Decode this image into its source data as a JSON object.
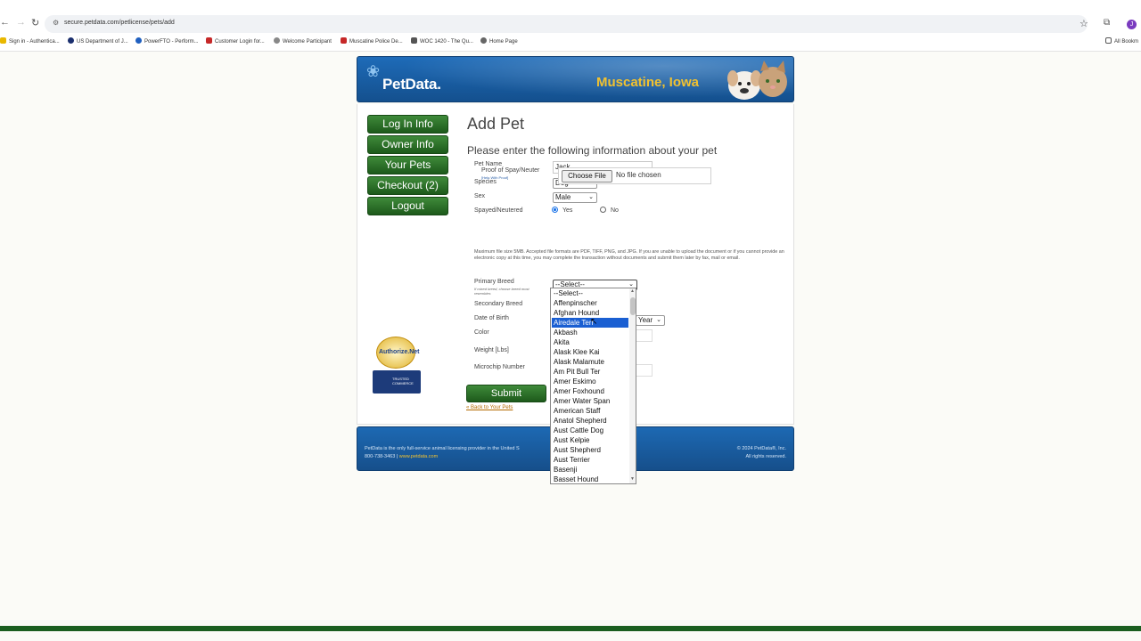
{
  "browser": {
    "url": "secure.petdata.com/petlicense/pets/add",
    "profile_initial": "J",
    "bookmarks": [
      "Sign in - Authentica...",
      "US Department of J...",
      "PowerFTO - Perform...",
      "Customer Login for...",
      "Welcome Participant",
      "Muscatine Police De...",
      "WOC 1420 - The Qu...",
      "Home Page"
    ],
    "all_bookmarks_label": "All Bookm"
  },
  "banner": {
    "logo": "PetData.",
    "city": "Muscatine, Iowa"
  },
  "menu": {
    "login_info": "Log In Info",
    "owner_info": "Owner Info",
    "your_pets": "Your Pets",
    "checkout": "Checkout (2)",
    "logout": "Logout"
  },
  "badges": {
    "authorize": "Authorize.Net",
    "trusted": "TRUSTED COMMERCE"
  },
  "form": {
    "title": "Add Pet",
    "subtitle": "Please enter the following information about your pet",
    "pet_name_label": "Pet Name",
    "pet_name_value": "Jack",
    "species_label": "Species",
    "species_value": "Dog",
    "sex_label": "Sex",
    "sex_value": "Male",
    "spayed_label": "Spayed/Neutered",
    "yes_label": "Yes",
    "no_label": "No",
    "proof_label": "Proof of Spay/Neuter",
    "proof_help": "[Help With Proof]",
    "choose_file": "Choose File",
    "no_file": "No file chosen",
    "note": "Maximum file size 5MB. Accepted file formats are PDF, TIFF, PNG, and JPG. If you are unable to upload the document or if you cannot provide an electronic copy at this time, you may complete the transaction without documents and submit them later by fax, mail or email.",
    "primary_breed_label": "Primary Breed",
    "primary_breed_hint": "If mixed breed, choose breed most resembles",
    "primary_breed_value": "--Select--",
    "secondary_breed_label": "Secondary Breed",
    "dob_label": "Date of Birth",
    "dob_year": "Year",
    "color_label": "Color",
    "weight_label": "Weight [Lbs]",
    "microchip_label": "Microchip Number",
    "submit": "Submit",
    "back_link": "« Back to Your Pets"
  },
  "breed_dropdown": {
    "selected": "Airedale Terr",
    "options": [
      "--Select--",
      "Affenpinscher",
      "Afghan Hound",
      "Airedale Terr",
      "Akbash",
      "Akita",
      "Alask Klee Kai",
      "Alask Malamute",
      "Am Pit Bull Ter",
      "Amer Eskimo",
      "Amer Foxhound",
      "Amer Water Span",
      "American Staff",
      "Anatol Shepherd",
      "Aust Cattle Dog",
      "Aust Kelpie",
      "Aust Shepherd",
      "Aust Terrier",
      "Basenji",
      "Basset Hound"
    ]
  },
  "footer": {
    "line1": "PetData is the only full-service animal licensing provider in the United S",
    "phone": "800-738-3463 |",
    "site": "www.petdata.com",
    "copyright": "© 2024 PetData®, Inc.",
    "rights": "All rights reserved."
  }
}
